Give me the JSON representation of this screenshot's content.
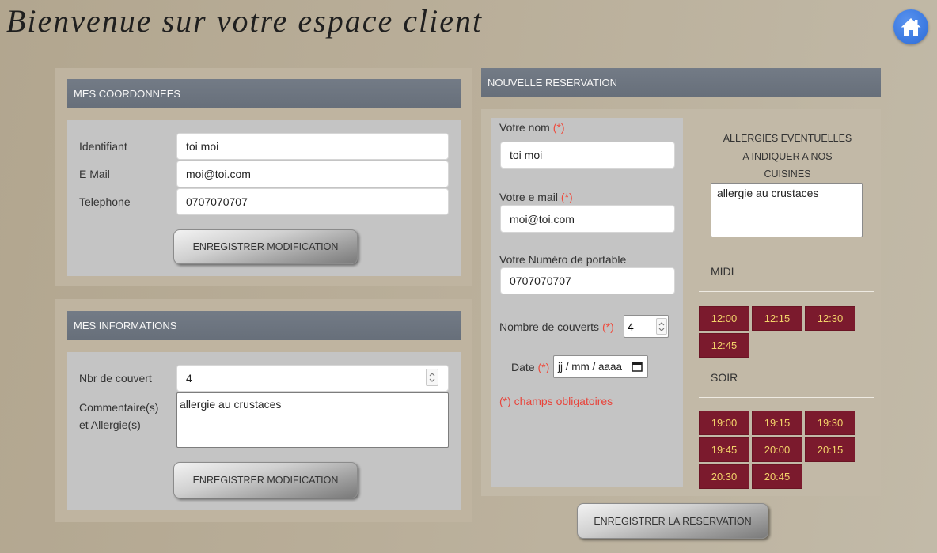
{
  "page": {
    "title": "Bienvenue sur votre espace client"
  },
  "coordonnees": {
    "heading": "MES COORDONNEES",
    "identifiant_label": "Identifiant",
    "identifiant_value": "toi moi",
    "email_label": "E Mail",
    "email_value": "moi@toi.com",
    "telephone_label": "Telephone",
    "telephone_value": "0707070707",
    "save_label": "ENREGISTRER MODIFICATION"
  },
  "informations": {
    "heading": "MES INFORMATIONS",
    "couvert_label": "Nbr de couvert",
    "couvert_value": "4",
    "comment_label_line1": "Commentaire(s)",
    "comment_label_line2": "et Allergie(s)",
    "comment_value": "allergie au crustaces",
    "save_label": "ENREGISTRER MODIFICATION"
  },
  "reservation": {
    "heading": "NOUVELLE RESERVATION",
    "required_mark": "(*)",
    "name_label": "Votre nom",
    "name_value": "toi moi",
    "email_label": "Votre e mail",
    "email_value": "moi@toi.com",
    "phone_label": "Votre Numéro de portable",
    "phone_value": "0707070707",
    "covers_label": "Nombre de couverts",
    "covers_value": "4",
    "date_label": "Date",
    "date_placeholder": "jj / mm / aaaa",
    "required_note": "(*) champs obligatoires",
    "allergies_title": [
      "ALLERGIES EVENTUELLES",
      "A INDIQUER A NOS",
      "CUISINES"
    ],
    "allergies_value": "allergie au crustaces",
    "midi_label": "MIDI",
    "midi_slots": [
      "12:00",
      "12:15",
      "12:30",
      "12:45"
    ],
    "soir_label": "SOIR",
    "soir_slots": [
      "19:00",
      "19:15",
      "19:30",
      "19:45",
      "20:00",
      "20:15",
      "20:30",
      "20:45"
    ],
    "submit_label": "ENREGISTRER LA RESERVATION"
  },
  "icons": {
    "home": "home-icon",
    "spinner": "spinner-arrows-icon",
    "calendar": "calendar-icon"
  },
  "colors": {
    "background": "#b8ad97",
    "header_bar": "#6b737e",
    "panel_grey": "#c4c4c4",
    "slot_bg": "#7b1a2d",
    "slot_text": "#f3d36a",
    "required_red": "#e8453c",
    "home_blue": "#3d7be2"
  }
}
